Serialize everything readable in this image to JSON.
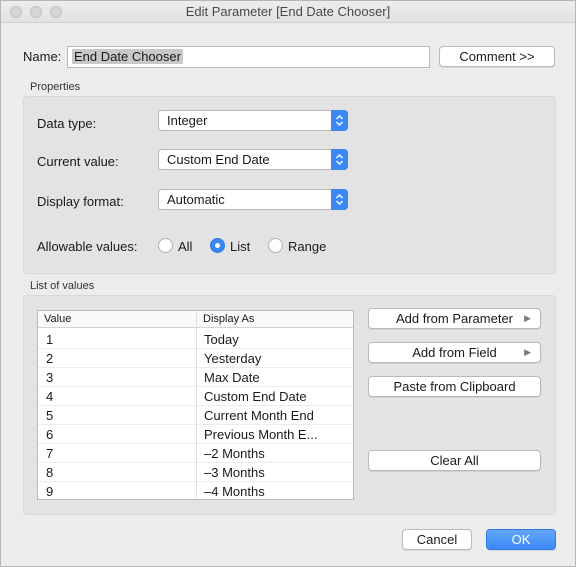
{
  "window": {
    "title": "Edit Parameter [End Date Chooser]"
  },
  "name": {
    "label": "Name:",
    "value": "End Date Chooser",
    "comment_button": "Comment >>"
  },
  "properties": {
    "label": "Properties",
    "data_type": {
      "label": "Data type:",
      "value": "Integer"
    },
    "current_value": {
      "label": "Current value:",
      "value": "Custom End Date"
    },
    "display_format": {
      "label": "Display format:",
      "value": "Automatic"
    },
    "allowable_values": {
      "label": "Allowable values:",
      "options": [
        "All",
        "List",
        "Range"
      ],
      "selected": "List"
    }
  },
  "list_of_values": {
    "label": "List of values",
    "columns": [
      "Value",
      "Display As"
    ],
    "rows": [
      {
        "value": "1",
        "display": "Today"
      },
      {
        "value": "2",
        "display": "Yesterday"
      },
      {
        "value": "3",
        "display": "Max Date"
      },
      {
        "value": "4",
        "display": "Custom End Date"
      },
      {
        "value": "5",
        "display": "Current Month End"
      },
      {
        "value": "6",
        "display": "Previous Month E..."
      },
      {
        "value": "7",
        "display": "–2 Months"
      },
      {
        "value": "8",
        "display": "–3 Months"
      },
      {
        "value": "9",
        "display": "–4 Months"
      }
    ],
    "buttons": {
      "add_from_parameter": "Add from Parameter",
      "add_from_field": "Add from Field",
      "paste": "Paste from Clipboard",
      "clear_all": "Clear All"
    }
  },
  "footer": {
    "cancel": "Cancel",
    "ok": "OK"
  },
  "colors": {
    "accent": "#3b88f5",
    "panel": "#e3e3e3",
    "window": "#ececec"
  }
}
